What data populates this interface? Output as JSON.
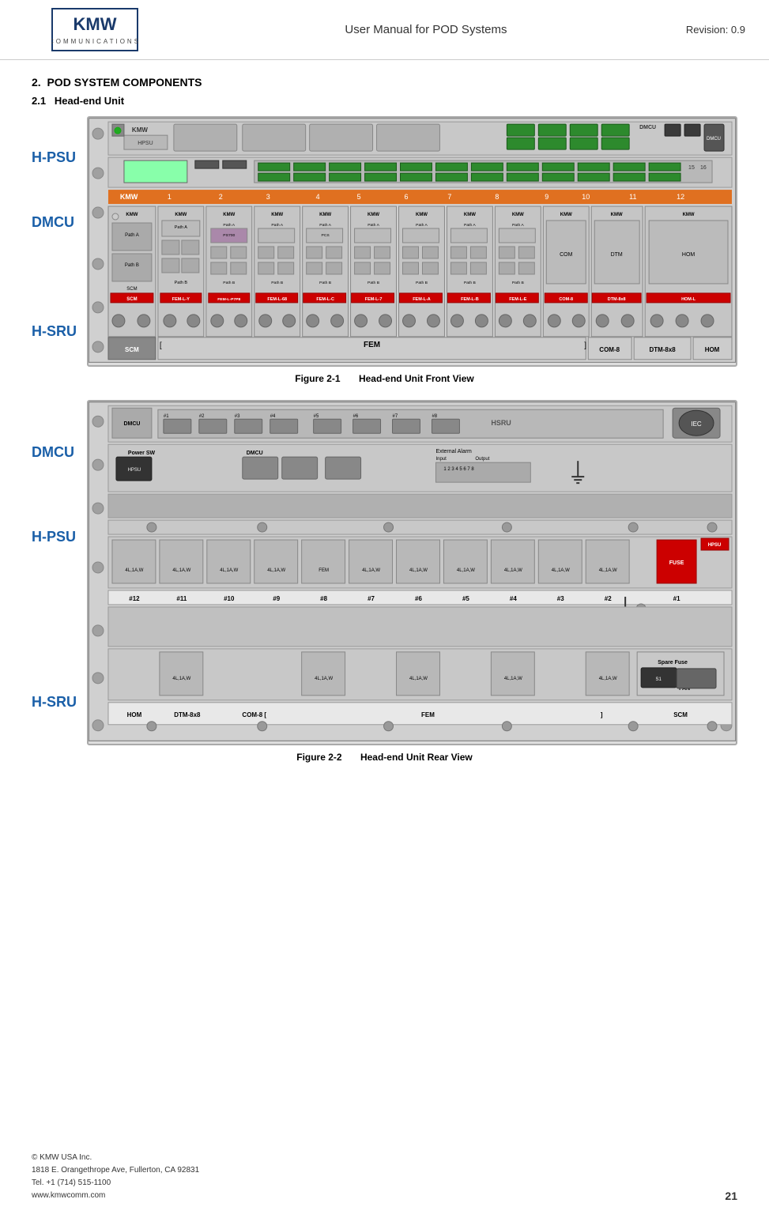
{
  "header": {
    "logo_text": "KMW",
    "logo_subtitle": "COMMUNICATIONS",
    "center_title": "User Manual for POD Systems",
    "revision": "Revision: 0.9"
  },
  "section": {
    "number": "2.",
    "title": "POD SYSTEM COMPONENTS"
  },
  "subsection": {
    "number": "2.1",
    "title": "Head-end Unit"
  },
  "figure1": {
    "id": "Figure 2-1",
    "caption": "Head-end Unit Front View"
  },
  "figure2": {
    "id": "Figure 2-2",
    "caption": "Head-end Unit Rear View"
  },
  "labels": {
    "hpsu": "H-PSU",
    "dmcu": "DMCU",
    "hsru": "H-SRU"
  },
  "front_bottom_labels": [
    "SCM",
    "[",
    "FEM",
    "]  COM-8",
    "DTM-8x8",
    "HOM"
  ],
  "rear_bottom_labels": [
    "HOM",
    "DTM-8x8",
    "COM-8 [",
    "FEM",
    "]",
    "SCM"
  ],
  "number_row": [
    "1",
    "2",
    "3",
    "4",
    "5",
    "6",
    "7",
    "8",
    "9",
    "10",
    "11",
    "12"
  ],
  "rear_slots": [
    "#12",
    "#11",
    "#10",
    "#9",
    "#8",
    "#7",
    "#6",
    "#5",
    "#4",
    "#3",
    "#2",
    "#1"
  ],
  "footer": {
    "copyright": "© KMW USA Inc.",
    "address": "1818 E. Orangethrope Ave, Fullerton, CA 92831",
    "tel": "Tel. +1 (714) 515-1100",
    "website": "www.kmwcomm.com",
    "page_number": "21"
  }
}
